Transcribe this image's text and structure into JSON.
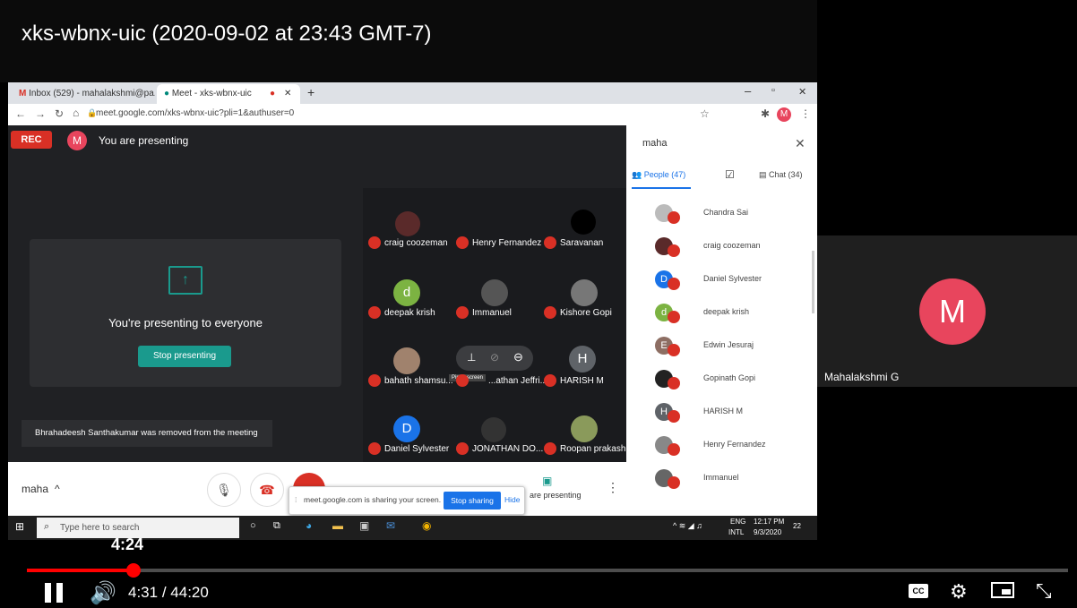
{
  "video": {
    "title": "xks-wbnx-uic (2020-09-02 at 23:43 GMT-7)"
  },
  "browser": {
    "tabs": [
      {
        "label": "Inbox (529) - mahalakshmi@pa..."
      },
      {
        "label": "Meet - xks-wbnx-uic"
      }
    ],
    "url": "meet.google.com/xks-wbnx-uic?pli=1&authuser=0",
    "profile_initial": "M"
  },
  "meet": {
    "rec_label": "REC",
    "presenter_initial": "M",
    "presenting_status": "You are presenting",
    "present_card_text": "You're presenting to everyone",
    "stop_presenting_label": "Stop presenting",
    "toast": "Bhrahadeesh Santhakumar was removed from the meeting",
    "tiles": [
      {
        "name": "craig coozeman"
      },
      {
        "name": "Henry Fernandez"
      },
      {
        "name": "Saravanan"
      },
      {
        "name": "deepak krish",
        "initial": "d"
      },
      {
        "name": "Immanuel"
      },
      {
        "name": "Kishore Gopi"
      },
      {
        "name": "bahath shamsu..."
      },
      {
        "name": "...athan Jeffri..."
      },
      {
        "name": "HARISH M",
        "initial": "H"
      },
      {
        "name": "Daniel Sylvester",
        "initial": "D"
      },
      {
        "name": "JONATHAN DO..."
      },
      {
        "name": "Roopan prakash"
      }
    ],
    "pin_tooltip": "Pin to screen",
    "bottom": {
      "meeting_name": "maha",
      "chevron": "^",
      "presenting_label": "are presenting"
    },
    "share_notice": {
      "text": "meet.google.com is sharing your screen.",
      "stop_label": "Stop sharing",
      "hide_label": "Hide"
    }
  },
  "panel": {
    "search_value": "maha",
    "tabs": {
      "people": "People (47)",
      "chat": "Chat (34)"
    },
    "people": [
      {
        "name": "Chandra Sai"
      },
      {
        "name": "craig coozeman"
      },
      {
        "name": "Daniel Sylvester",
        "initial": "D",
        "color": "#1a73e8"
      },
      {
        "name": "deepak krish",
        "initial": "d",
        "color": "#7cb342"
      },
      {
        "name": "Edwin Jesuraj",
        "initial": "E",
        "color": "#8d6e63"
      },
      {
        "name": "Gopinath Gopi"
      },
      {
        "name": "HARISH M",
        "initial": "H",
        "color": "#5f6368"
      },
      {
        "name": "Henry Fernandez"
      },
      {
        "name": "Immanuel"
      }
    ]
  },
  "taskbar": {
    "search_placeholder": "Type here to search",
    "lang": "ENG",
    "lang2": "INTL",
    "time": "12:17 PM",
    "date": "9/3/2020",
    "notif_count": "22"
  },
  "side_tile": {
    "initial": "M",
    "name": "Mahalakshmi G"
  },
  "player": {
    "hover_time": "4:24",
    "current_time": "4:31",
    "separator": "/",
    "duration": "44:20",
    "progress": 0.102
  },
  "colors": {
    "accent": "#ff0000",
    "meet_red": "#d93025",
    "avatar_pink": "#e8455d"
  }
}
